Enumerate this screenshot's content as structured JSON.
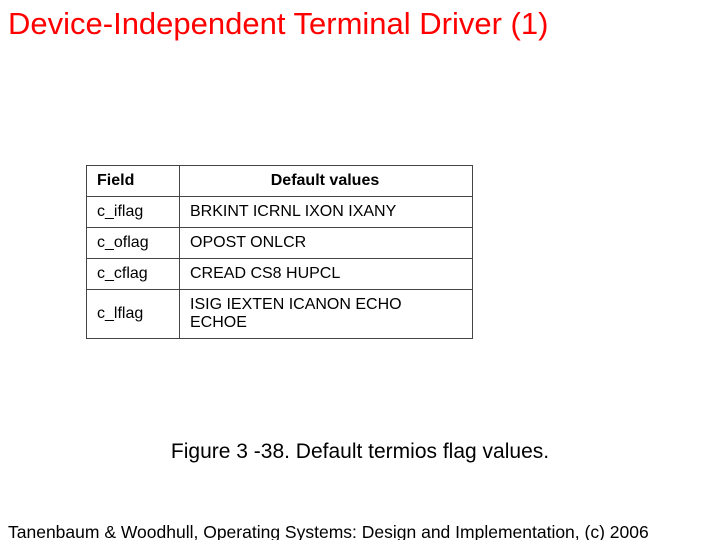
{
  "title": "Device-Independent Terminal Driver (1)",
  "table": {
    "headers": {
      "field": "Field",
      "values": "Default values"
    },
    "rows": [
      {
        "field": "c_iflag",
        "values": "BRKINT ICRNL IXON IXANY"
      },
      {
        "field": "c_oflag",
        "values": "OPOST ONLCR"
      },
      {
        "field": "c_cflag",
        "values": "CREAD CS8 HUPCL"
      },
      {
        "field": "c_lflag",
        "values": "ISIG IEXTEN ICANON ECHO ECHOE"
      }
    ]
  },
  "caption": "Figure 3 -38. Default termios flag values.",
  "footer": "Tanenbaum & Woodhull, Operating Systems: Design and Implementation, (c) 2006"
}
